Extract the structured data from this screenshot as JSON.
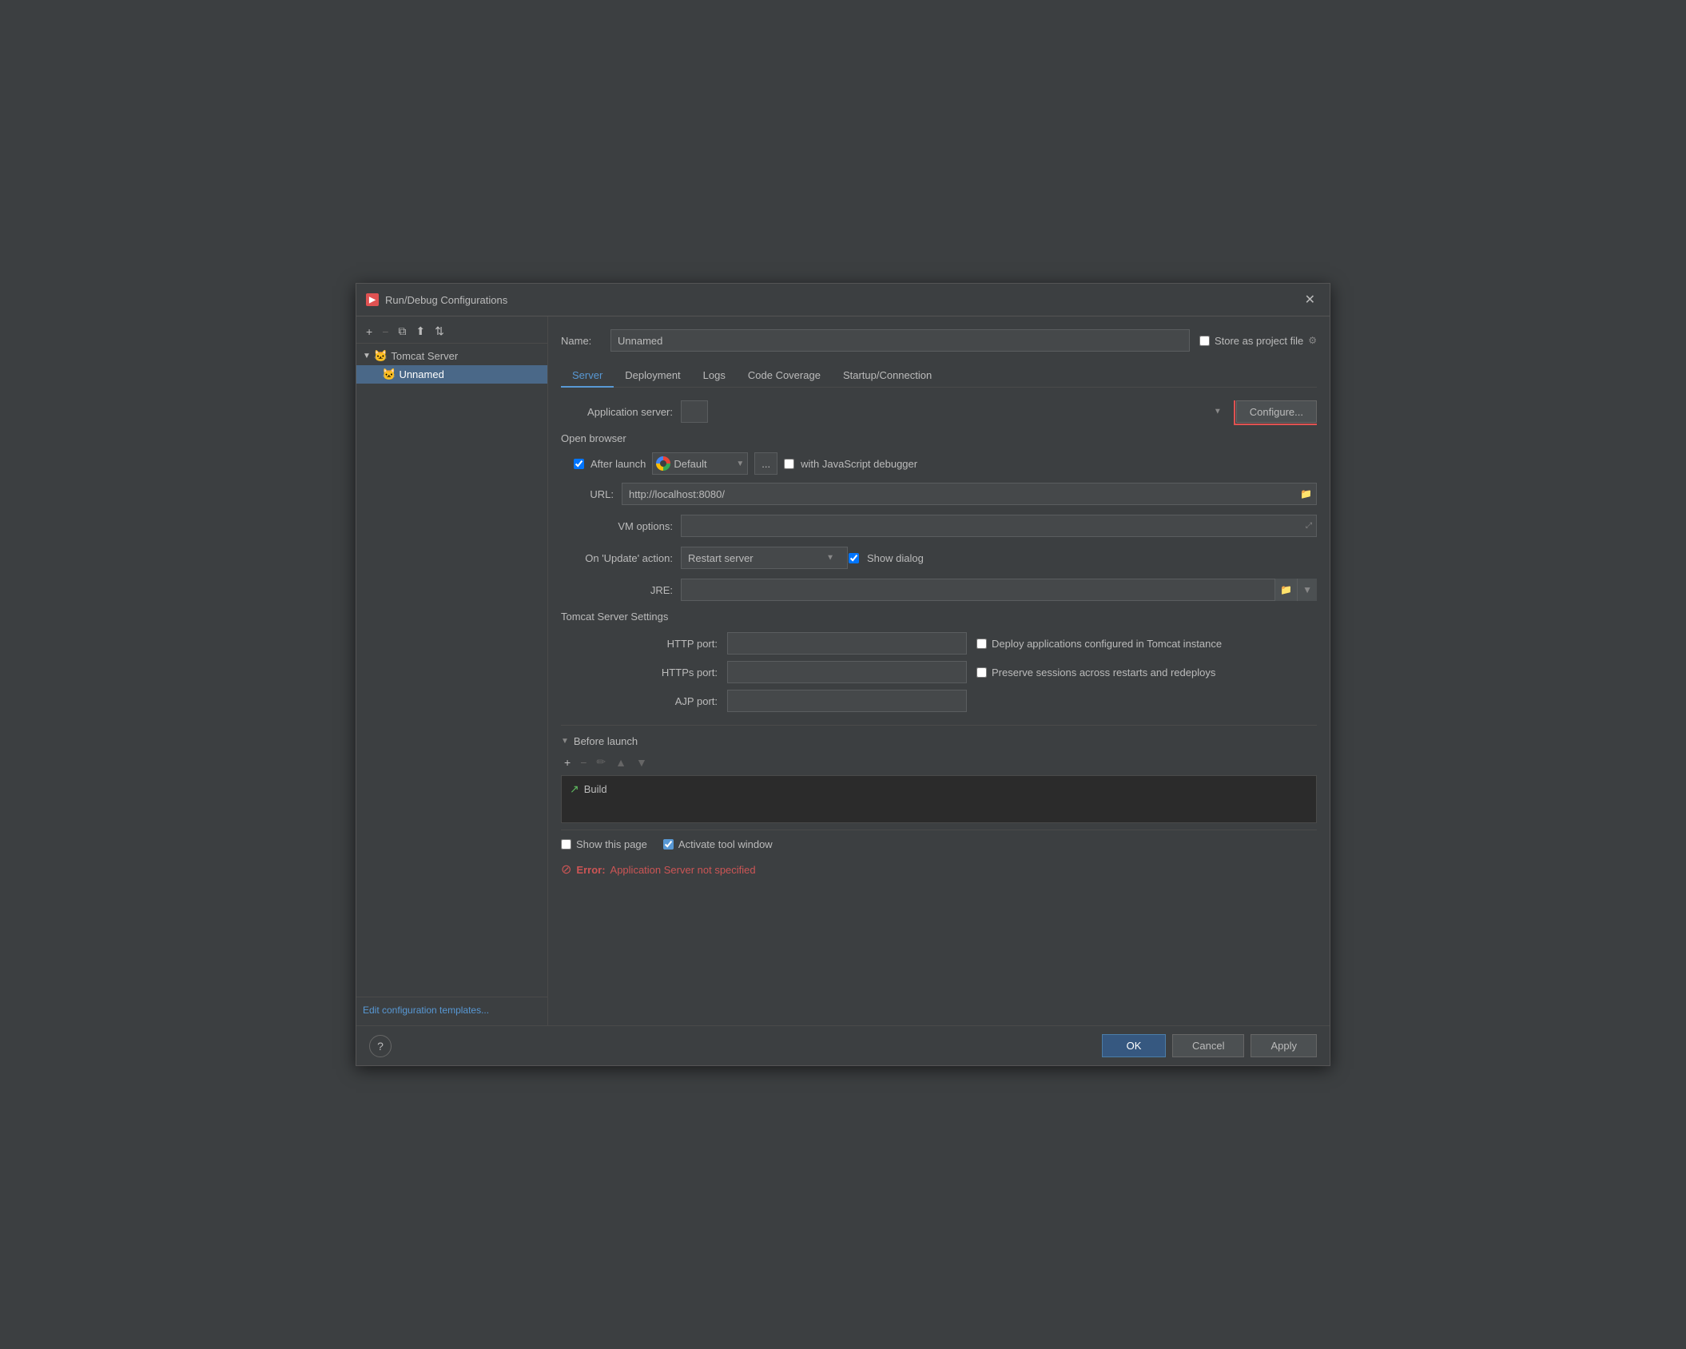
{
  "dialog": {
    "title": "Run/Debug Configurations",
    "title_icon": "▶",
    "close_icon": "✕"
  },
  "toolbar": {
    "add_label": "+",
    "remove_label": "−",
    "copy_label": "⧉",
    "move_up_label": "⬆",
    "sort_label": "⇅"
  },
  "sidebar": {
    "tree": {
      "parent_label": "Tomcat Server",
      "parent_arrow": "▼",
      "parent_icon": "🐱",
      "child_label": "Unnamed",
      "child_icon": "🐱"
    },
    "footer_link": "Edit configuration templates..."
  },
  "header": {
    "name_label": "Name:",
    "name_value": "Unnamed",
    "store_label": "Store as project file",
    "gear_icon": "⚙"
  },
  "tabs": {
    "items": [
      {
        "id": "server",
        "label": "Server",
        "active": true
      },
      {
        "id": "deployment",
        "label": "Deployment",
        "active": false
      },
      {
        "id": "logs",
        "label": "Logs",
        "active": false
      },
      {
        "id": "code-coverage",
        "label": "Code Coverage",
        "active": false
      },
      {
        "id": "startup",
        "label": "Startup/Connection",
        "active": false
      }
    ]
  },
  "server_tab": {
    "app_server_label": "Application server:",
    "app_server_value": "",
    "configure_label": "Configure...",
    "open_browser_title": "Open browser",
    "after_launch_label": "After launch",
    "after_launch_checked": true,
    "browser_value": "Default",
    "dots_label": "...",
    "with_js_debugger_label": "with JavaScript debugger",
    "with_js_debugger_checked": false,
    "url_label": "URL:",
    "url_value": "http://localhost:8080/",
    "folder_icon": "📁",
    "vm_options_label": "VM options:",
    "vm_options_value": "",
    "expand_icon": "⤢",
    "on_update_label": "On 'Update' action:",
    "on_update_value": "Restart server",
    "show_dialog_checked": true,
    "show_dialog_label": "Show dialog",
    "jre_label": "JRE:",
    "jre_value": "",
    "tomcat_settings_title": "Tomcat Server Settings",
    "http_port_label": "HTTP port:",
    "http_port_value": "",
    "https_port_label": "HTTPs port:",
    "https_port_value": "",
    "ajp_port_label": "AJP port:",
    "ajp_port_value": "",
    "deploy_apps_label": "Deploy applications configured in Tomcat instance",
    "deploy_apps_checked": false,
    "preserve_sessions_label": "Preserve sessions across restarts and redeploys",
    "preserve_sessions_checked": false
  },
  "before_launch": {
    "title": "Before launch",
    "collapse_icon": "▼",
    "add_icon": "+",
    "remove_icon": "−",
    "edit_icon": "✏",
    "up_icon": "▲",
    "down_icon": "▼",
    "items": [
      {
        "label": "Build",
        "icon": "↗"
      }
    ]
  },
  "bottom": {
    "show_this_page_label": "Show this page",
    "show_this_page_checked": false,
    "activate_tool_label": "Activate tool window",
    "activate_tool_checked": true
  },
  "error_bar": {
    "icon": "⊘",
    "bold_text": "Error:",
    "message": " Application Server not specified"
  },
  "footer": {
    "help_label": "?",
    "ok_label": "OK",
    "cancel_label": "Cancel",
    "apply_label": "Apply"
  }
}
